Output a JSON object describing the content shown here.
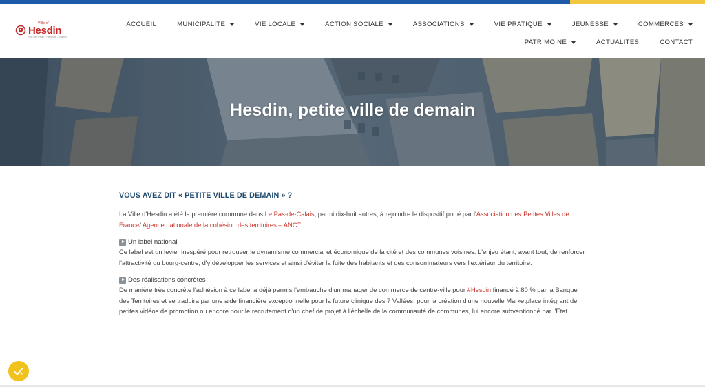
{
  "colors": {
    "accent_blue": "#1e5aa8",
    "accent_yellow": "#f1c740",
    "link_red": "#c9342a",
    "heading_blue": "#1f4a6e",
    "fab_yellow": "#f2c21c"
  },
  "logo": {
    "small": "Ville d'",
    "name": "Hesdin",
    "tagline": "Ville de Hesdin · Pays des 7 Vallées"
  },
  "nav": {
    "row1": [
      {
        "label": "ACCUEIL",
        "dropdown": false
      },
      {
        "label": "MUNICIPALITÉ",
        "dropdown": true
      },
      {
        "label": "VIE LOCALE",
        "dropdown": true
      },
      {
        "label": "ACTION SOCIALE",
        "dropdown": true
      },
      {
        "label": "ASSOCIATIONS",
        "dropdown": true
      },
      {
        "label": "VIE PRATIQUE",
        "dropdown": true
      },
      {
        "label": "JEUNESSE",
        "dropdown": true
      },
      {
        "label": "COMMERCES",
        "dropdown": true
      }
    ],
    "row2": [
      {
        "label": "PATRIMOINE",
        "dropdown": true
      },
      {
        "label": "ACTUALITÉS",
        "dropdown": false
      },
      {
        "label": "CONTACT",
        "dropdown": false
      }
    ]
  },
  "hero": {
    "title": "Hesdin, petite ville de demain"
  },
  "article": {
    "heading": "VOUS AVEZ DIT « PETITE VILLE DE DEMAIN » ?",
    "intro": {
      "t1": "La Ville d'Hesdin a été la première commune dans ",
      "link1": "Le Pas-de-Calais",
      "t2": ", parmi dix-huit autres, à rejoindre le dispositif porté par l'",
      "link2": "Association des Petites Villes de France",
      "t3": "/ ",
      "link3": "Agence nationale de la cohésion des territoires – ANCT"
    },
    "section1": {
      "title": "Un label national",
      "text": "Ce label est un levier inespéré pour retrouver le dynamisme commercial et économique de la cité et des communes voisines. L'enjeu étant, avant tout, de renforcer l'attractivité du bourg-centre, d'y développer les services et ainsi d'éviter la fuite des habitants et des consommateurs vers l'extérieur du territoire."
    },
    "section2": {
      "title": "Des réalisations concrètes",
      "t1": "De manière très concrète l'adhésion à ce label a déjà permis l'embauche d'un manager de commerce de centre-ville pour ",
      "link": "#Hesdin",
      "t2": " financé à 80 % par la Banque des Territoires et se traduira par une aide financière exceptionnelle pour la future clinique des 7 Vallées, pour la création d'une nouvelle Marketplace intégrant de petites vidéos de promotion ou encore pour le recrutement d'un chef de projet à l'échelle de la communauté de communes, lui encore subventionné par l'État."
    }
  },
  "icons": {
    "logo": "coat-of-arms-icon",
    "play": "play-icon",
    "fab": "check-sparkle-icon",
    "caret": "caret-down-icon"
  }
}
